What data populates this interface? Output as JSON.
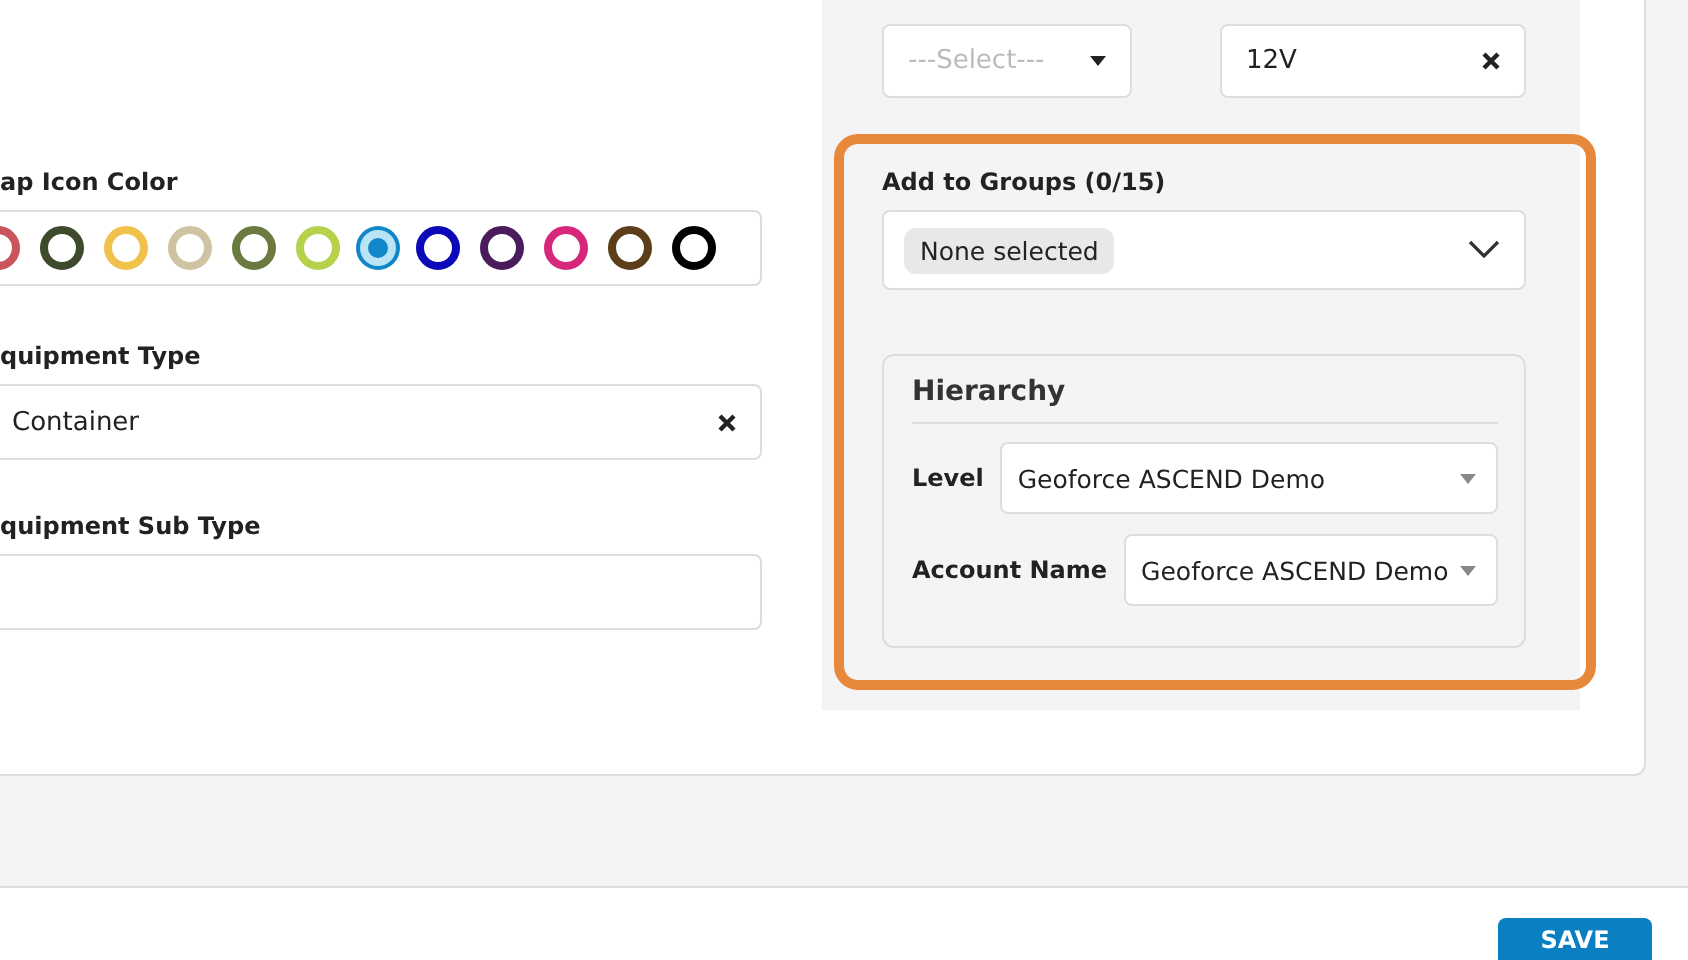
{
  "left": {
    "map_icon_color": {
      "label": "ap Icon Color",
      "swatches": [
        {
          "color": "#c9545a",
          "selected": false
        },
        {
          "color": "#3e4a2c",
          "selected": false
        },
        {
          "color": "#f0c24c",
          "selected": false
        },
        {
          "color": "#cfc3a4",
          "selected": false
        },
        {
          "color": "#6b7a3e",
          "selected": false
        },
        {
          "color": "#b5d24a",
          "selected": false
        },
        {
          "color": "#1187c9",
          "selected": true
        },
        {
          "color": "#0a0ab8",
          "selected": false
        },
        {
          "color": "#4a1c5c",
          "selected": false
        },
        {
          "color": "#d6277a",
          "selected": false
        },
        {
          "color": "#5c3f1a",
          "selected": false
        },
        {
          "color": "#000000",
          "selected": false
        }
      ]
    },
    "equipment_type": {
      "label": "quipment Type",
      "value": "Container"
    },
    "equipment_sub_type": {
      "label": "quipment Sub Type"
    }
  },
  "right": {
    "fuel_type": {
      "placeholder": "---Select---"
    },
    "battery_voltage": {
      "value": "12V"
    },
    "groups": {
      "label": "Add to Groups (0/15)",
      "chip": "None selected"
    },
    "hierarchy": {
      "title": "Hierarchy",
      "fields": [
        {
          "label": "Level",
          "value": "Geoforce ASCEND Demo"
        },
        {
          "label": "Account Name",
          "value": "Geoforce ASCEND Demo"
        }
      ]
    }
  },
  "footer": {
    "save": "SAVE"
  }
}
